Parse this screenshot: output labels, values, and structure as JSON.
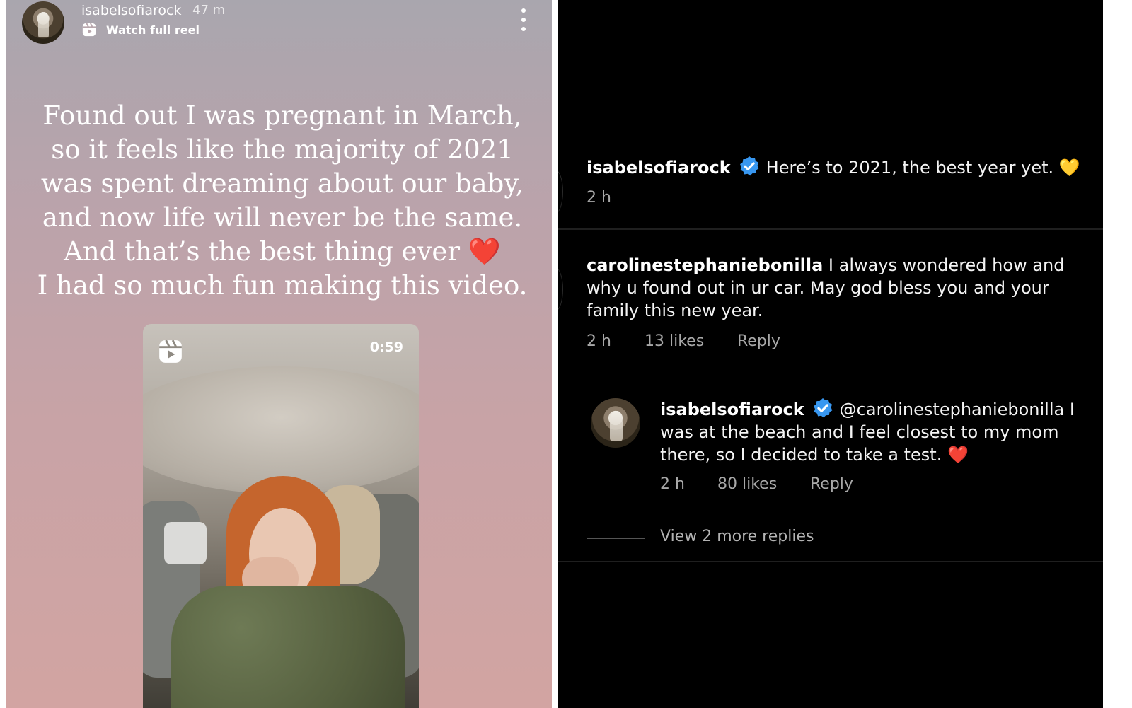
{
  "story": {
    "username": "isabelsofiarock",
    "time": "47 m",
    "watch_label": "Watch full reel",
    "caption_lines": [
      "Found out I was pregnant in March,",
      "so it feels like the majority of 2021",
      "was spent dreaming about our baby,",
      "and now life will never be the same.",
      "And that’s the best thing ever",
      "I had so much fun making this video."
    ],
    "heart_emoji": "❤️",
    "reel_duration": "0:59"
  },
  "comments": {
    "caption": {
      "username": "isabelsofiarock",
      "text": "Here’s to 2021, the best year yet.",
      "emoji": "💛",
      "time": "2 h"
    },
    "comment1": {
      "username": "carolinestephaniebonilla",
      "text": "I always wondered how and why u found out in ur car. May god bless you and your family this new year.",
      "time": "2 h",
      "likes": "13 likes",
      "reply_label": "Reply"
    },
    "reply1": {
      "username": "isabelsofiarock",
      "text": "@carolinestephaniebonilla I was at the beach and I feel closest to my mom there, so I decided to take a test.",
      "emoji": "❤️",
      "time": "2 h",
      "likes": "80 likes",
      "reply_label": "Reply"
    },
    "view_more": "View 2 more replies"
  },
  "colors": {
    "verified_blue": "#3897f0",
    "meta_gray": "#a8a8a8",
    "heart_red": "#e0161b"
  }
}
